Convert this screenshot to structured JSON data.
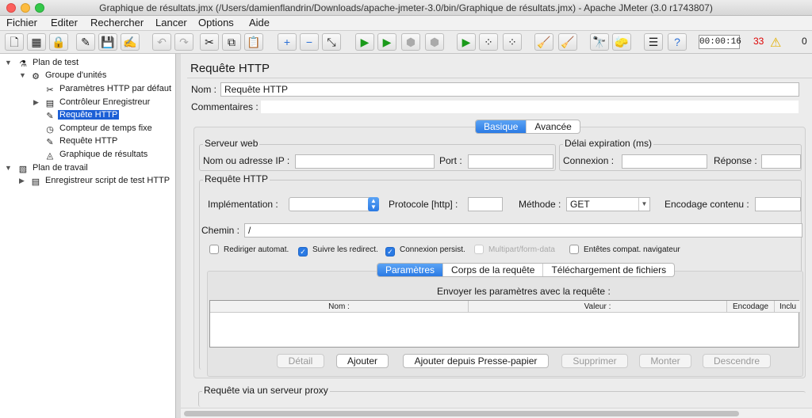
{
  "window": {
    "title": "Graphique de résultats.jmx (/Users/damienflandrin/Downloads/apache-jmeter-3.0/bin/Graphique de résultats.jmx) - Apache JMeter (3.0 r1743807)"
  },
  "menu": [
    "Fichier",
    "Editer",
    "Rechercher",
    "Lancer",
    "Options",
    "Aide"
  ],
  "status": {
    "timer": "00:00:16",
    "errors": "33",
    "threads": "0"
  },
  "tree": [
    {
      "label": "Plan de test",
      "icon": "flask-icon",
      "glyph": "⚗"
    },
    {
      "label": "Groupe d'unités",
      "icon": "gear-icon",
      "glyph": "⚙"
    },
    {
      "label": "Paramètres HTTP par défaut",
      "icon": "tools-icon",
      "glyph": "✂"
    },
    {
      "label": "Contrôleur Enregistreur",
      "icon": "script-icon",
      "glyph": "▤"
    },
    {
      "label": "Requête HTTP",
      "icon": "pipette-icon",
      "glyph": "✎"
    },
    {
      "label": "Compteur de temps fixe",
      "icon": "timer-icon",
      "glyph": "◷"
    },
    {
      "label": "Requête HTTP",
      "icon": "pipette-icon",
      "glyph": "✎"
    },
    {
      "label": "Graphique de résultats",
      "icon": "chart-icon",
      "glyph": "◬"
    },
    {
      "label": "Plan de travail",
      "icon": "workbench-icon",
      "glyph": "▧"
    },
    {
      "label": "Enregistreur script de test HTTP",
      "icon": "recorder-icon",
      "glyph": "▤"
    }
  ],
  "panel": {
    "title": "Requête HTTP",
    "name_label": "Nom :",
    "name_value": "Requête HTTP",
    "comments_label": "Commentaires :",
    "mode_tabs": [
      "Basique",
      "Avancée"
    ],
    "server": {
      "title": "Serveur web",
      "host_label": "Nom ou adresse IP :",
      "port_label": "Port :"
    },
    "timeout": {
      "title": "Délai expiration (ms)",
      "connect_label": "Connexion :",
      "response_label": "Réponse :"
    },
    "request": {
      "title": "Requête HTTP",
      "impl_label": "Implémentation :",
      "protocol_label": "Protocole [http] :",
      "method_label": "Méthode :",
      "method_value": "GET",
      "encoding_label": "Encodage contenu :",
      "path_label": "Chemin :",
      "path_value": "/"
    },
    "checkboxes": [
      {
        "label": "Rediriger automat.",
        "checked": false,
        "disabled": false
      },
      {
        "label": "Suivre les redirect.",
        "checked": true,
        "disabled": false
      },
      {
        "label": "Connexion persist.",
        "checked": true,
        "disabled": false
      },
      {
        "label": "Multipart/form-data",
        "checked": false,
        "disabled": true
      },
      {
        "label": "Entêtes compat. navigateur",
        "checked": false,
        "disabled": false
      }
    ],
    "param_tabs": [
      "Paramètres",
      "Corps de la requête",
      "Téléchargement de fichiers"
    ],
    "send_params": "Envoyer les paramètres avec la requête :",
    "columns": [
      "Nom :",
      "Valeur :",
      "Encodage",
      "Inclu"
    ],
    "buttons": [
      {
        "label": "Détail",
        "disabled": true
      },
      {
        "label": "Ajouter",
        "disabled": false
      },
      {
        "label": "Ajouter depuis Presse-papier",
        "disabled": false
      },
      {
        "label": "Supprimer",
        "disabled": true
      },
      {
        "label": "Monter",
        "disabled": true
      },
      {
        "label": "Descendre",
        "disabled": true
      }
    ],
    "proxy_title": "Requête via un serveur proxy"
  },
  "colors": {
    "accent": "#2a7ae4",
    "selection": "#1c5fd6",
    "error": "#dd0000"
  }
}
